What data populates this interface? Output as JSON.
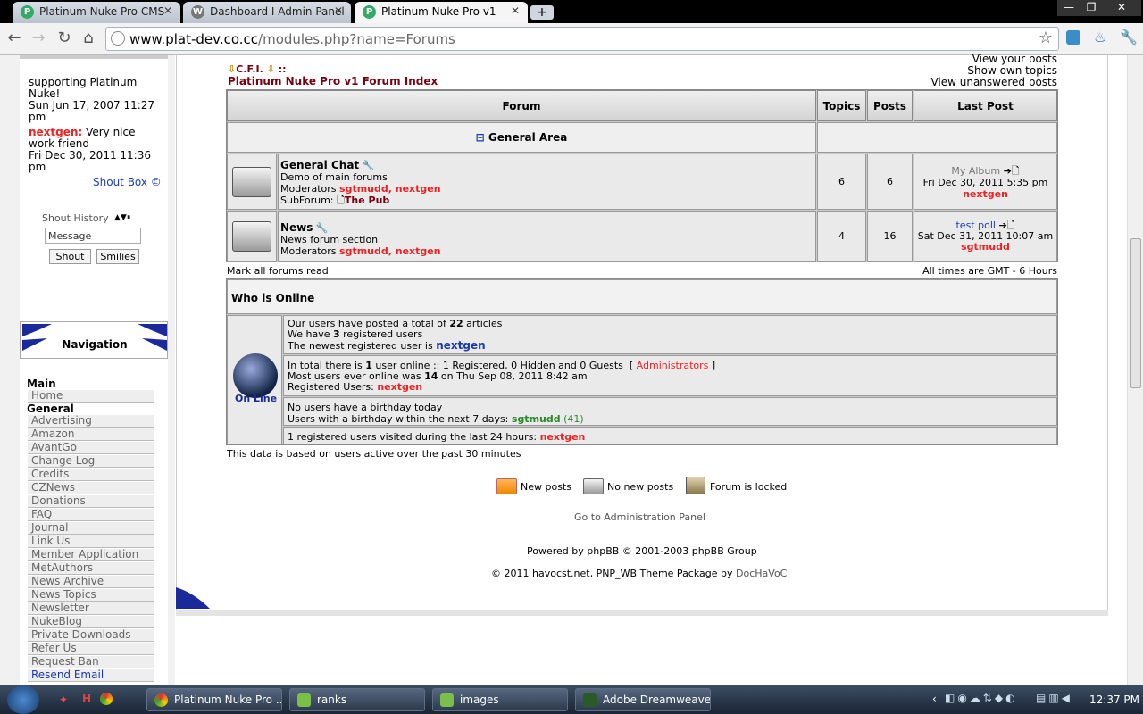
{
  "browser": {
    "tabs": [
      {
        "label": "Platinum Nuke Pro CMS",
        "icon": "P"
      },
      {
        "label": "Dashboard I Admin Panel",
        "icon": "wp"
      },
      {
        "label": "Platinum Nuke Pro v1",
        "icon": "P"
      }
    ],
    "new_tab": "+",
    "url_host": "www.plat-dev.co.cc",
    "url_path": "/modules.php?name=Forums",
    "window_controls": {
      "minimize": "—",
      "maximize": "❐",
      "close": "✕"
    }
  },
  "shoutbox": {
    "msg1": "supporting Platinum Nuke!",
    "date1": "Sun Jun 17, 2007 11:27 pm",
    "user2": "nextgen:",
    "msg2": "Very nice work friend",
    "date2": "Fri Dec 30, 2011 11:36 pm",
    "link": "Shout Box ©",
    "history": "Shout History",
    "input_placeholder": "Message",
    "shout_button": "Shout",
    "smilies_button": "Smilies"
  },
  "navigation": {
    "title": "Navigation",
    "main": "Main",
    "home": "Home",
    "general": "General",
    "items": [
      "Advertising",
      "Amazon",
      "AvantGo",
      "Change Log",
      "Credits",
      "CZNews",
      "Donations",
      "FAQ",
      "Journal",
      "Link Us",
      "Member Application",
      "MetAuthors",
      "News Archive",
      "News Topics",
      "Newsletter",
      "NukeBlog",
      "Private Downloads",
      "Refer Us",
      "Request Ban",
      "Resend Email"
    ]
  },
  "forum": {
    "breadcrumb_top": "C.F.I.",
    "breadcrumb_sep": "::",
    "index_title": "Platinum Nuke Pro v1 Forum Index",
    "links": [
      "View your posts",
      "Show own topics",
      "View unanswered posts"
    ],
    "headers": {
      "forum": "Forum",
      "topics": "Topics",
      "posts": "Posts",
      "last_post": "Last Post"
    },
    "category": "General Area",
    "category_toggle": "⊟",
    "rows": [
      {
        "name": "General Chat",
        "desc": "Demo of main forums",
        "moderators_label": "Moderators",
        "moderators": "sgtmudd, nextgen",
        "subforum_label": "SubForum:",
        "subforum": "The Pub",
        "topics": "6",
        "posts": "6",
        "last_title": "My Album",
        "last_date": "Fri Dec 30, 2011 5:35 pm",
        "last_user": "nextgen"
      },
      {
        "name": "News",
        "desc": "News forum section",
        "moderators_label": "Moderators",
        "moderators": "sgtmudd, nextgen",
        "topics": "4",
        "posts": "16",
        "last_title": "test poll",
        "last_date": "Sat Dec 31, 2011 10:07 am",
        "last_user": "sgtmudd"
      }
    ],
    "mark_all": "Mark all forums read",
    "timezone": "All times are GMT - 6 Hours"
  },
  "who_online": {
    "title": "Who is Online",
    "online_label": "On Line",
    "stats_line1_pre": "Our users have posted a total of",
    "stats_articles": "22",
    "stats_line1_post": "articles",
    "stats_line2_pre": "We have",
    "stats_registered": "3",
    "stats_line2_post": "registered users",
    "stats_line3": "The newest registered user is",
    "newest_user": "nextgen",
    "online_line1_pre": "In total there is",
    "online_count": "1",
    "online_line1_post": "user online :: 1 Registered, 0 Hidden and 0 Guests",
    "administrators": "Administrators",
    "online_line2_pre": "Most users ever online was",
    "online_max": "14",
    "online_line2_post": "on Thu Sep 08, 2011 8:42 am",
    "online_line3": "Registered Users:",
    "online_user": "nextgen",
    "birthday_line1": "No users have a birthday today",
    "birthday_line2": "Users with a birthday within the next 7 days:",
    "birthday_user": "sgtmudd",
    "birthday_age": "(41)",
    "visited_line": "1 registered users visited during the last 24 hours:",
    "visited_user": "nextgen",
    "data_note": "This data is based on users active over the past 30 minutes"
  },
  "legend": {
    "new_posts": "New posts",
    "no_new_posts": "No new posts",
    "locked": "Forum is locked"
  },
  "footer": {
    "admin_link": "Go to Administration Panel",
    "powered": "Powered by phpBB © 2001-2003 phpBB Group",
    "copyright": "© 2011 havocst.net, PNP_WB Theme Package by",
    "author": "DocHaVoC"
  },
  "taskbar": {
    "items": [
      "Platinum Nuke Pro ...",
      "ranks",
      "images",
      "Adobe Dreamweave..."
    ],
    "clock": "12:37 PM"
  },
  "colors": {
    "red": "#e22222",
    "blue": "#1a3bb0",
    "dark_red": "#7a0010",
    "nav_blue": "#1a2a9a"
  }
}
